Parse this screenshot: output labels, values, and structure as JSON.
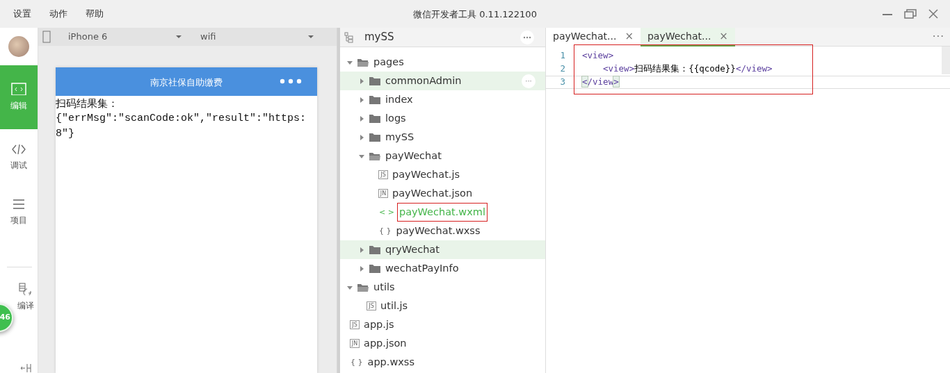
{
  "window": {
    "title": "微信开发者工具 0.11.122100",
    "menu": [
      "设置",
      "动作",
      "帮助"
    ]
  },
  "sidebar": {
    "items": [
      {
        "kind": "edit",
        "label": "编辑",
        "selected": true
      },
      {
        "kind": "debug",
        "label": "调试",
        "selected": false
      },
      {
        "kind": "project",
        "label": "项目",
        "selected": false
      },
      {
        "kind": "compile",
        "label": "编译",
        "selected": false
      },
      {
        "kind": "cut",
        "selected": false
      }
    ],
    "badge": "46"
  },
  "simulator": {
    "device": "iPhone 6",
    "network": "wifi",
    "nav_title": "南京社保自助缴费",
    "content": [
      "扫码结果集：",
      "{\"errMsg\":\"scanCode:ok\",\"result\":\"https:",
      "8\"}"
    ]
  },
  "file_tree": {
    "project": "mySS",
    "items": [
      {
        "kind": "folder",
        "name": "pages",
        "expanded": true,
        "selected": false,
        "highlighted": false,
        "children": [
          {
            "kind": "folder",
            "name": "commonAdmin",
            "expanded": false,
            "selected": false,
            "highlighted": true,
            "more": "···"
          },
          {
            "kind": "folder",
            "name": "index",
            "expanded": false,
            "selected": false,
            "highlighted": false
          },
          {
            "kind": "folder",
            "name": "logs",
            "expanded": false,
            "selected": false,
            "highlighted": false
          },
          {
            "kind": "folder",
            "name": "mySS",
            "expanded": false,
            "selected": false,
            "highlighted": false
          },
          {
            "kind": "folder",
            "name": "payWechat",
            "expanded": true,
            "selected": false,
            "highlighted": false,
            "children": [
              {
                "kind": "file",
                "badge": "JS",
                "name": "payWechat.js",
                "selected": false,
                "highlighted": false
              },
              {
                "kind": "file",
                "badge": "JN",
                "name": "payWechat.json",
                "selected": false,
                "highlighted": false
              },
              {
                "kind": "file",
                "badge": "< >",
                "name": "payWechat.wxml",
                "selected": true,
                "highlighted": false,
                "annotated": true
              },
              {
                "kind": "file",
                "badge": "{ }",
                "name": "payWechat.wxss",
                "selected": false,
                "highlighted": false
              }
            ]
          },
          {
            "kind": "folder",
            "name": "qryWechat",
            "expanded": false,
            "selected": false,
            "highlighted": true
          },
          {
            "kind": "folder",
            "name": "wechatPayInfo",
            "expanded": false,
            "selected": false,
            "highlighted": false
          }
        ]
      },
      {
        "kind": "folder",
        "name": "utils",
        "expanded": true,
        "selected": false,
        "highlighted": false,
        "children": [
          {
            "kind": "file",
            "badge": "JS",
            "name": "util.js",
            "selected": false,
            "highlighted": false
          }
        ]
      },
      {
        "kind": "file",
        "badge": "JS",
        "name": "app.js",
        "selected": false,
        "highlighted": false
      },
      {
        "kind": "file",
        "badge": "JN",
        "name": "app.json",
        "selected": false,
        "highlighted": false
      },
      {
        "kind": "file",
        "badge": "{ }",
        "name": "app.wxss",
        "selected": false,
        "highlighted": false
      }
    ]
  },
  "editor": {
    "tabs": [
      {
        "label": "payWechat...",
        "close": "×",
        "selected": false
      },
      {
        "label": "payWechat...",
        "close": "×",
        "selected": true
      }
    ],
    "more": "···",
    "annotated": true,
    "lines": [
      {
        "number": "1",
        "current": false,
        "tokens": [
          {
            "kind": "tag",
            "text": "<view>"
          }
        ],
        "children": [
          {
            "number": "2",
            "current": false,
            "tokens": [
              {
                "kind": "tag",
                "text": "<view>"
              },
              {
                "kind": "text",
                "text": "扫码结果集：{{qcode}}"
              },
              {
                "kind": "tag",
                "text": "</view>"
              }
            ]
          }
        ]
      },
      {
        "number": "3",
        "current": true,
        "tokens": [
          {
            "kind": "match",
            "text": "<"
          },
          {
            "kind": "tag",
            "text": "/view"
          },
          {
            "kind": "match",
            "text": ">"
          }
        ]
      }
    ]
  }
}
